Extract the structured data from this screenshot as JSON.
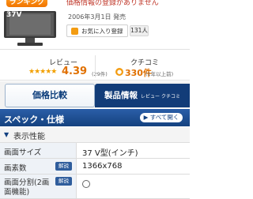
{
  "header": {
    "badge": "ランキング",
    "notice": "価格情報の登録がありません"
  },
  "product": {
    "screen_label": "37V",
    "release": "2006年3月1日 発売",
    "favorite_label": "お気に入り登録",
    "favorite_count": "131人"
  },
  "review": {
    "title": "レビュー",
    "stars": "★★★★★",
    "score": "4.39",
    "count": "(29件)"
  },
  "kuchikomi": {
    "title": "クチコミ",
    "count": "330件",
    "period": "(1年以上前)"
  },
  "tabs": {
    "price": "価格比較",
    "spec": "製品情報",
    "spec_sub": "レビュー クチコミ"
  },
  "section": {
    "title": "スペック・仕様",
    "see_all": "▶ すべて開く"
  },
  "subsection": {
    "title": "表示性能",
    "icon": "▼"
  },
  "specs": {
    "row1": {
      "label": "画面サイズ",
      "value": "37 V型(インチ)"
    },
    "row2": {
      "label": "画素数",
      "badge": "解説",
      "value": "1366x768"
    },
    "row3": {
      "label_line1": "画面分割(2画",
      "label_line2": "面機能)",
      "badge": "解説"
    }
  },
  "colors": {
    "accent_blue": "#123c78",
    "accent_orange": "#e07000"
  }
}
